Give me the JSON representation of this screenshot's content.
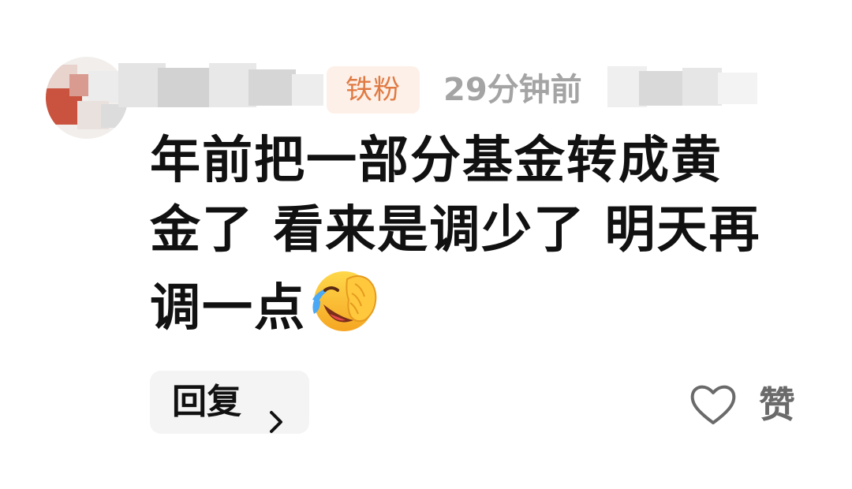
{
  "comment": {
    "badge": "铁粉",
    "time": "29分钟前",
    "text_line1": "年前把一部分基金转成黄",
    "text_line2": "金了 看来是调少了 明天再",
    "text_line3": "调一点"
  },
  "actions": {
    "reply_label": "回复",
    "like_label": "赞"
  },
  "icons": {
    "avatar": "avatar-icon",
    "emoji": "laughing-crying-facepalm-emoji",
    "chevron": "chevron-right-icon",
    "like": "heart-outline-icon"
  },
  "colors": {
    "badge_text": "#e07a43",
    "badge_bg": "#fdf0e8",
    "meta_text": "#a4a4a4",
    "body_text": "#111111",
    "reply_bg": "#f4f4f4"
  }
}
